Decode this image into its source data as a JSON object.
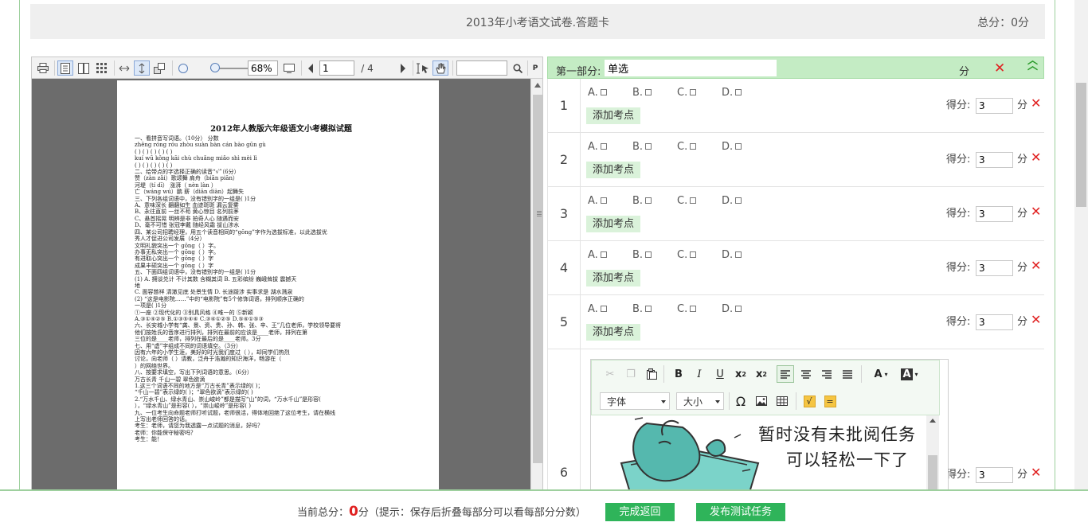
{
  "header": {
    "title": "2013年小考语文试卷.答题卡",
    "total_score": "总分：0分"
  },
  "viewer": {
    "zoom": "68%",
    "page_current": "1",
    "page_total": "/ 4",
    "search_value": "",
    "page": {
      "title": "2012年人教版六年级语文小考模拟试题",
      "lines": [
        "一、看拼音写词语。（10分）                                        分数",
        "zhěng  róng    róu  zhòu    suàn  bàn  cán  bào  gūn  gù",
        "(          )  (          )   (          )  (          )  (          )",
        "kuí  wū   kǒng  kāi  chù  chuǎng      miǎo  shì    mèi    lì",
        "(          )  (          )   (          )   (          )  (          )",
        "二、给带点的字选择正确的读音“√”（6分）",
        "   赞（zàn  zǎi）歌颂舞               肩舟（biān  piān）",
        "   河堤（tí   dī）                    涨湃（ nèn  làn ）",
        "     亡（wáng  wú）鹏                薪（diān  diàn）起舞失",
        "三、下列各组词语中，没有错别字的一组是(   )1分",
        "    A、意味深长  翻翻如生  血迹斑斑   漏云复雾",
        "    B、永往直前    一丝不苟  黄心惊目    名列前茅",
        "    C、悬首摇晃      明辨是非     拍奇人心      随遇而安",
        "    D、毫不可惜      张冠李戴    随经风霜      拔山涉水",
        "四、某公司招聘经理，用五个读音相同的“gōng”字作为选拔标准，以此选拔优",
        "      秀人才促进公司发展（4分）",
        "           文明礼貌突出一个 gōng（    ）字。",
        "           办事无私突出一个 gōng（    ）字。",
        "           有进取心突出一个 gōng（    ）字",
        "           成果丰硕突出一个 gōng（    ）字",
        "五、下面四组词语中，没有错别字的一组是(     )1分",
        "    (1)  A. 拥谈兑计    不计其数    含糊其词    B. 五彩缤纷  巍峨耸拔  震撼天",
        "地",
        "          C. 面容慈祥   清澈见底    处景生情   D. 长途跋涉  实事求是  湖水溅泉",
        "   (2) “这是电影院……”中的“电影院”有5个修饰词语，排列顺序正确的",
        "   一项是(    )1分",
        "     ①一座 ②现代化的 ③别具风格 ④唯一的 ⑤新颖",
        "        A.③①④②⑤   B.①③⑤④④   C.③④①②⑤    D.⑤④①⑤③",
        "六、长安城小学有“龚、景、资、贵、孙、韩、张、辛、王”几位老师，学校领导要将",
        "      他们按姓氏的音序进行排列，排列在最前的应该是____老师，排列在第",
        "      三位的是____老师，排列在最后的是____老师。3分",
        "七、用“虚”字组成不同的词语填空。（3分）",
        "      因有六年的小学生涯，美好的时光我们度过（             ），却同学们热烈",
        "      讨论，向老师（          ）请教，泛舟于浩瀚的知识海洋，畅游在（",
        "      ）的网络世界。",
        "八、按要求填空，写出下列词语的意思。（6分）",
        "                  万古长青              千山一碧              翠色欲滴",
        "   1.这三个词语不同的地方是“万古长青”表示绿的(                          )；",
        "   “千山一碧”表示绿的(                  )；“翠色欲滴”表示绿的(          )",
        "   2.“万水千山、绿水青山、崇山峻岭”都是描写“山”的词，“万水千山”是形容(",
        "   ），“绿水青山”是形容(              ），“崇山峻岭”是形容(                 )",
        "九、一位考生向命题老师打听试题，老师很活，得体地回绝了这位考生，请在横线",
        "      上写出老师回答的话。",
        "  考生：老师，请您为我透露一点试题的消息，好吗？",
        "  老师：你能保守秘密吗？",
        "  考生：能！"
      ]
    }
  },
  "section": {
    "label": "第一部分:",
    "name": "单选",
    "fen": "分"
  },
  "questions": [
    {
      "num": "1",
      "options": [
        "A.",
        "B.",
        "C.",
        "D."
      ],
      "add_point": "添加考点",
      "score_label": "得分:",
      "score": "3",
      "fen": "分"
    },
    {
      "num": "2",
      "options": [
        "A.",
        "B.",
        "C.",
        "D."
      ],
      "add_point": "添加考点",
      "score_label": "得分:",
      "score": "3",
      "fen": "分"
    },
    {
      "num": "3",
      "options": [
        "A.",
        "B.",
        "C.",
        "D."
      ],
      "add_point": "添加考点",
      "score_label": "得分:",
      "score": "3",
      "fen": "分"
    },
    {
      "num": "4",
      "options": [
        "A.",
        "B.",
        "C.",
        "D."
      ],
      "add_point": "添加考点",
      "score_label": "得分:",
      "score": "3",
      "fen": "分"
    },
    {
      "num": "5",
      "options": [
        "A.",
        "B.",
        "C.",
        "D."
      ],
      "add_point": "添加考点",
      "score_label": "得分:",
      "score": "3",
      "fen": "分"
    },
    {
      "num": "6",
      "score_label": "得分:",
      "score": "3",
      "fen": "分"
    }
  ],
  "editor": {
    "font_label": "字体",
    "size_label": "大小",
    "message_line1": "暂时没有未批阅任务",
    "message_line2": "可以轻松一下了"
  },
  "footer": {
    "total_prefix": "当前总分：",
    "total_value": "0",
    "total_suffix": "分（提示：保存后折叠每部分可以看每部分分数）",
    "done_button": "完成返回",
    "publish_button": "发布测试任务"
  },
  "colors": {
    "accent_green": "#2fb45a",
    "section_bg": "#c4ecc4",
    "delete_red": "#e02020"
  }
}
